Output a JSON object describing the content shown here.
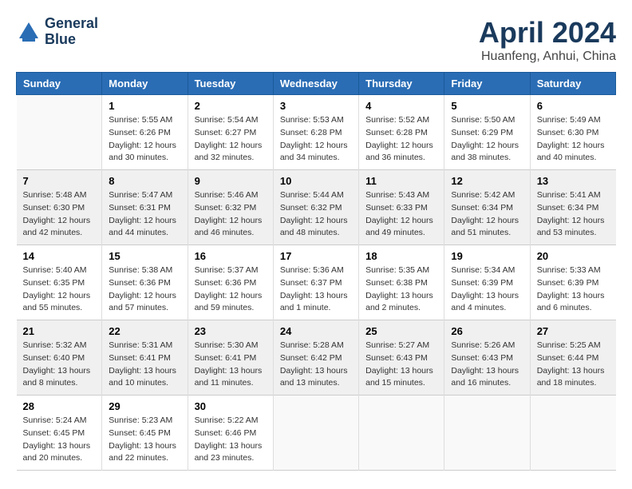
{
  "header": {
    "logo_line1": "General",
    "logo_line2": "Blue",
    "month_title": "April 2024",
    "location": "Huanfeng, Anhui, China"
  },
  "weekdays": [
    "Sunday",
    "Monday",
    "Tuesday",
    "Wednesday",
    "Thursday",
    "Friday",
    "Saturday"
  ],
  "weeks": [
    [
      {
        "day": "",
        "sunrise": "",
        "sunset": "",
        "daylight": ""
      },
      {
        "day": "1",
        "sunrise": "Sunrise: 5:55 AM",
        "sunset": "Sunset: 6:26 PM",
        "daylight": "Daylight: 12 hours and 30 minutes."
      },
      {
        "day": "2",
        "sunrise": "Sunrise: 5:54 AM",
        "sunset": "Sunset: 6:27 PM",
        "daylight": "Daylight: 12 hours and 32 minutes."
      },
      {
        "day": "3",
        "sunrise": "Sunrise: 5:53 AM",
        "sunset": "Sunset: 6:28 PM",
        "daylight": "Daylight: 12 hours and 34 minutes."
      },
      {
        "day": "4",
        "sunrise": "Sunrise: 5:52 AM",
        "sunset": "Sunset: 6:28 PM",
        "daylight": "Daylight: 12 hours and 36 minutes."
      },
      {
        "day": "5",
        "sunrise": "Sunrise: 5:50 AM",
        "sunset": "Sunset: 6:29 PM",
        "daylight": "Daylight: 12 hours and 38 minutes."
      },
      {
        "day": "6",
        "sunrise": "Sunrise: 5:49 AM",
        "sunset": "Sunset: 6:30 PM",
        "daylight": "Daylight: 12 hours and 40 minutes."
      }
    ],
    [
      {
        "day": "7",
        "sunrise": "Sunrise: 5:48 AM",
        "sunset": "Sunset: 6:30 PM",
        "daylight": "Daylight: 12 hours and 42 minutes."
      },
      {
        "day": "8",
        "sunrise": "Sunrise: 5:47 AM",
        "sunset": "Sunset: 6:31 PM",
        "daylight": "Daylight: 12 hours and 44 minutes."
      },
      {
        "day": "9",
        "sunrise": "Sunrise: 5:46 AM",
        "sunset": "Sunset: 6:32 PM",
        "daylight": "Daylight: 12 hours and 46 minutes."
      },
      {
        "day": "10",
        "sunrise": "Sunrise: 5:44 AM",
        "sunset": "Sunset: 6:32 PM",
        "daylight": "Daylight: 12 hours and 48 minutes."
      },
      {
        "day": "11",
        "sunrise": "Sunrise: 5:43 AM",
        "sunset": "Sunset: 6:33 PM",
        "daylight": "Daylight: 12 hours and 49 minutes."
      },
      {
        "day": "12",
        "sunrise": "Sunrise: 5:42 AM",
        "sunset": "Sunset: 6:34 PM",
        "daylight": "Daylight: 12 hours and 51 minutes."
      },
      {
        "day": "13",
        "sunrise": "Sunrise: 5:41 AM",
        "sunset": "Sunset: 6:34 PM",
        "daylight": "Daylight: 12 hours and 53 minutes."
      }
    ],
    [
      {
        "day": "14",
        "sunrise": "Sunrise: 5:40 AM",
        "sunset": "Sunset: 6:35 PM",
        "daylight": "Daylight: 12 hours and 55 minutes."
      },
      {
        "day": "15",
        "sunrise": "Sunrise: 5:38 AM",
        "sunset": "Sunset: 6:36 PM",
        "daylight": "Daylight: 12 hours and 57 minutes."
      },
      {
        "day": "16",
        "sunrise": "Sunrise: 5:37 AM",
        "sunset": "Sunset: 6:36 PM",
        "daylight": "Daylight: 12 hours and 59 minutes."
      },
      {
        "day": "17",
        "sunrise": "Sunrise: 5:36 AM",
        "sunset": "Sunset: 6:37 PM",
        "daylight": "Daylight: 13 hours and 1 minute."
      },
      {
        "day": "18",
        "sunrise": "Sunrise: 5:35 AM",
        "sunset": "Sunset: 6:38 PM",
        "daylight": "Daylight: 13 hours and 2 minutes."
      },
      {
        "day": "19",
        "sunrise": "Sunrise: 5:34 AM",
        "sunset": "Sunset: 6:39 PM",
        "daylight": "Daylight: 13 hours and 4 minutes."
      },
      {
        "day": "20",
        "sunrise": "Sunrise: 5:33 AM",
        "sunset": "Sunset: 6:39 PM",
        "daylight": "Daylight: 13 hours and 6 minutes."
      }
    ],
    [
      {
        "day": "21",
        "sunrise": "Sunrise: 5:32 AM",
        "sunset": "Sunset: 6:40 PM",
        "daylight": "Daylight: 13 hours and 8 minutes."
      },
      {
        "day": "22",
        "sunrise": "Sunrise: 5:31 AM",
        "sunset": "Sunset: 6:41 PM",
        "daylight": "Daylight: 13 hours and 10 minutes."
      },
      {
        "day": "23",
        "sunrise": "Sunrise: 5:30 AM",
        "sunset": "Sunset: 6:41 PM",
        "daylight": "Daylight: 13 hours and 11 minutes."
      },
      {
        "day": "24",
        "sunrise": "Sunrise: 5:28 AM",
        "sunset": "Sunset: 6:42 PM",
        "daylight": "Daylight: 13 hours and 13 minutes."
      },
      {
        "day": "25",
        "sunrise": "Sunrise: 5:27 AM",
        "sunset": "Sunset: 6:43 PM",
        "daylight": "Daylight: 13 hours and 15 minutes."
      },
      {
        "day": "26",
        "sunrise": "Sunrise: 5:26 AM",
        "sunset": "Sunset: 6:43 PM",
        "daylight": "Daylight: 13 hours and 16 minutes."
      },
      {
        "day": "27",
        "sunrise": "Sunrise: 5:25 AM",
        "sunset": "Sunset: 6:44 PM",
        "daylight": "Daylight: 13 hours and 18 minutes."
      }
    ],
    [
      {
        "day": "28",
        "sunrise": "Sunrise: 5:24 AM",
        "sunset": "Sunset: 6:45 PM",
        "daylight": "Daylight: 13 hours and 20 minutes."
      },
      {
        "day": "29",
        "sunrise": "Sunrise: 5:23 AM",
        "sunset": "Sunset: 6:45 PM",
        "daylight": "Daylight: 13 hours and 22 minutes."
      },
      {
        "day": "30",
        "sunrise": "Sunrise: 5:22 AM",
        "sunset": "Sunset: 6:46 PM",
        "daylight": "Daylight: 13 hours and 23 minutes."
      },
      {
        "day": "",
        "sunrise": "",
        "sunset": "",
        "daylight": ""
      },
      {
        "day": "",
        "sunrise": "",
        "sunset": "",
        "daylight": ""
      },
      {
        "day": "",
        "sunrise": "",
        "sunset": "",
        "daylight": ""
      },
      {
        "day": "",
        "sunrise": "",
        "sunset": "",
        "daylight": ""
      }
    ]
  ]
}
